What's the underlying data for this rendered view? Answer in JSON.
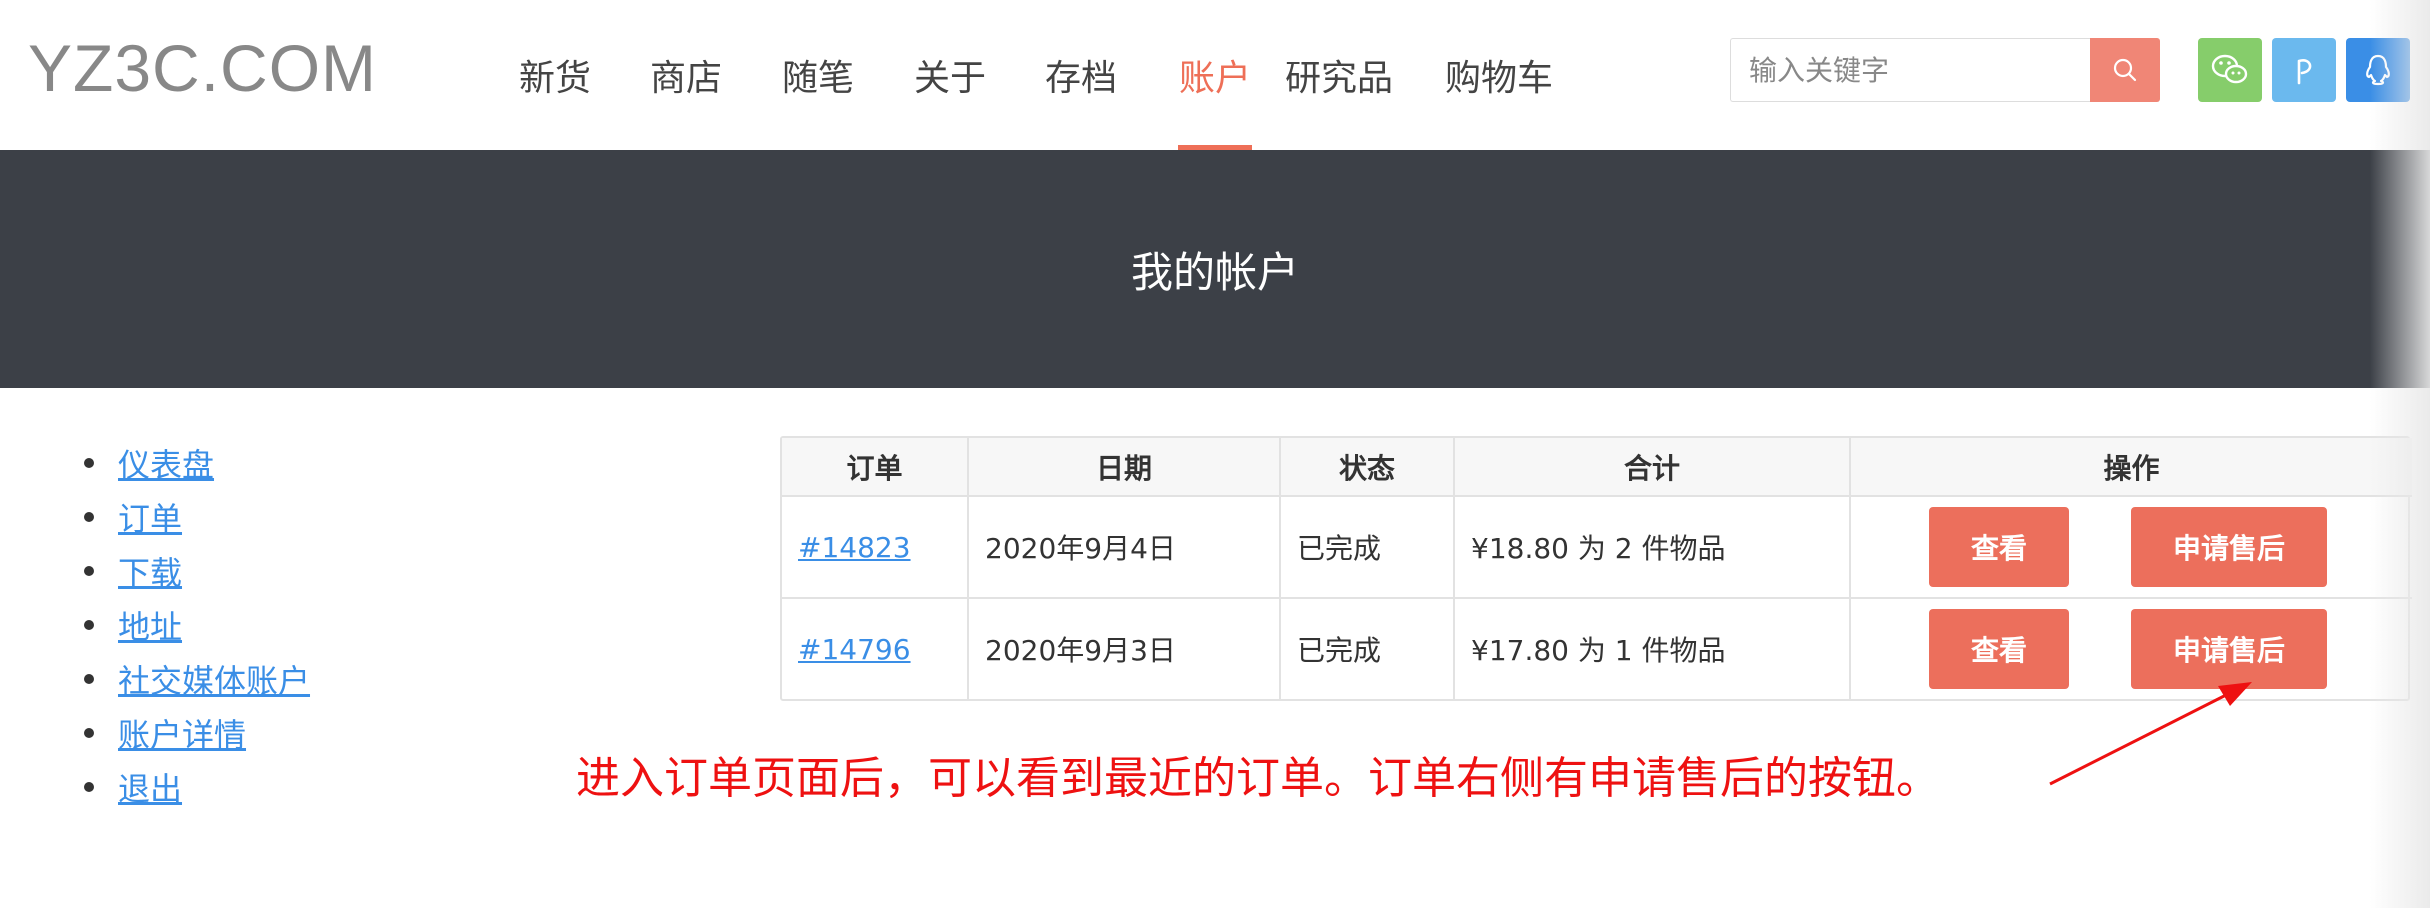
{
  "header": {
    "logo": "YZ3C.COM",
    "nav": [
      {
        "label": "新货",
        "active": false
      },
      {
        "label": "商店",
        "active": false
      },
      {
        "label": "随笔",
        "active": false
      },
      {
        "label": "关于",
        "active": false
      },
      {
        "label": "存档",
        "active": false
      },
      {
        "label": "账户",
        "active": true
      },
      {
        "label": "研究品",
        "active": false
      },
      {
        "label": "购物车",
        "active": false
      }
    ],
    "search": {
      "placeholder": "输入关键字",
      "value": "",
      "icon": "search-icon"
    },
    "social": [
      {
        "icon": "wechat-icon",
        "color": "#86cd6b"
      },
      {
        "icon": "weibo-p-icon",
        "color": "#6bb9ee"
      },
      {
        "icon": "qq-icon",
        "color": "#3a8ee6"
      }
    ],
    "accent_color": "#ee6f57"
  },
  "banner": {
    "title": "我的帐户",
    "background": "#3c4047"
  },
  "sidebar": {
    "items": [
      {
        "label": "仪表盘"
      },
      {
        "label": "订单"
      },
      {
        "label": "下载"
      },
      {
        "label": "地址"
      },
      {
        "label": "社交媒体账户"
      },
      {
        "label": "账户详情"
      },
      {
        "label": "退出"
      }
    ]
  },
  "orders": {
    "headers": [
      "订单",
      "日期",
      "状态",
      "合计",
      "操作"
    ],
    "rows": [
      {
        "order": "#14823",
        "date": "2020年9月4日",
        "status": "已完成",
        "total": "¥18.80 为 2 件物品",
        "view": "查看",
        "after_sale": "申请售后"
      },
      {
        "order": "#14796",
        "date": "2020年9月3日",
        "status": "已完成",
        "total": "¥17.80 为 1 件物品",
        "view": "查看",
        "after_sale": "申请售后"
      }
    ],
    "button_color": "#ec6f5c"
  },
  "annotation": {
    "text": "进入订单页面后，可以看到最近的订单。订单右侧有申请售后的按钮。",
    "color": "#ee1111"
  }
}
